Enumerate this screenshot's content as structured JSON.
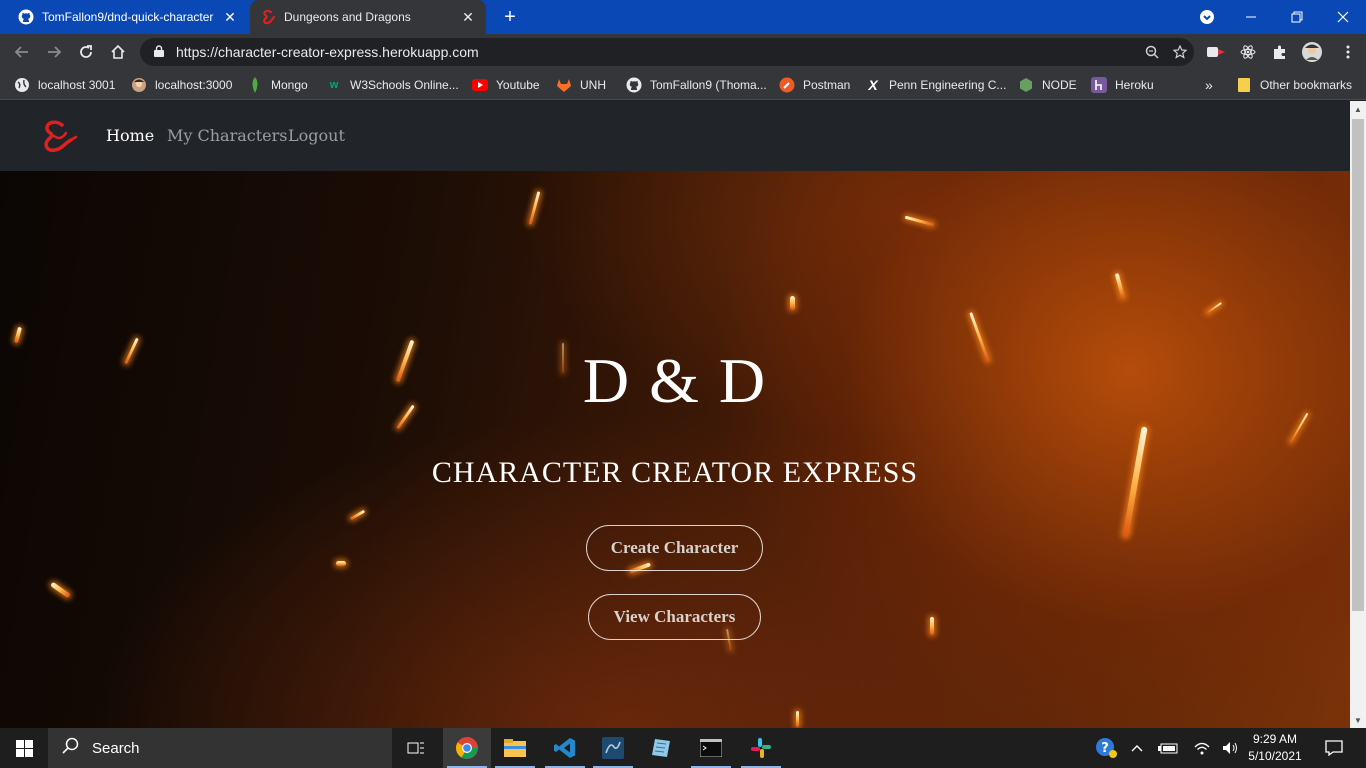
{
  "browser": {
    "tabs": [
      {
        "title": "TomFallon9/dnd-quick-character",
        "close": "✕",
        "icon": "github-icon"
      },
      {
        "title": "Dungeons and Dragons",
        "close": "✕",
        "icon": "dnd-ampersand-icon"
      }
    ],
    "new_tab": "+",
    "url": "https://character-creator-express.herokuapp.com",
    "bookmarks": [
      {
        "label": "localhost 3001",
        "icon": "globe-icon"
      },
      {
        "label": "localhost:3000",
        "icon": "avatar-icon"
      },
      {
        "label": "Mongo",
        "icon": "mongo-leaf-icon"
      },
      {
        "label": "W3Schools Online...",
        "icon": "w3schools-icon"
      },
      {
        "label": "Youtube",
        "icon": "youtube-icon"
      },
      {
        "label": "UNH",
        "icon": "gitlab-icon"
      },
      {
        "label": "TomFallon9 (Thoma...",
        "icon": "github-icon"
      },
      {
        "label": "Postman",
        "icon": "postman-icon"
      },
      {
        "label": "Penn Engineering C...",
        "icon": "x-icon"
      },
      {
        "label": "NODE",
        "icon": "node-icon"
      },
      {
        "label": "Heroku",
        "icon": "heroku-icon"
      }
    ],
    "bookmarks_overflow": "»",
    "other_bookmarks": "Other bookmarks"
  },
  "site": {
    "nav": {
      "home": "Home",
      "my_characters": "My Characters",
      "logout": "Logout"
    },
    "hero": {
      "title": "D & D",
      "subtitle": "CHARACTER CREATOR EXPRESS",
      "create_button": "Create Character",
      "view_button": "View Characters"
    }
  },
  "taskbar": {
    "search_placeholder": "Search",
    "time": "9:29 AM",
    "date": "5/10/2021"
  },
  "colors": {
    "tab_strip": "#0a49b5",
    "toolbar": "#35363a",
    "site_nav": "#212529",
    "brand_red": "#e0201f"
  }
}
